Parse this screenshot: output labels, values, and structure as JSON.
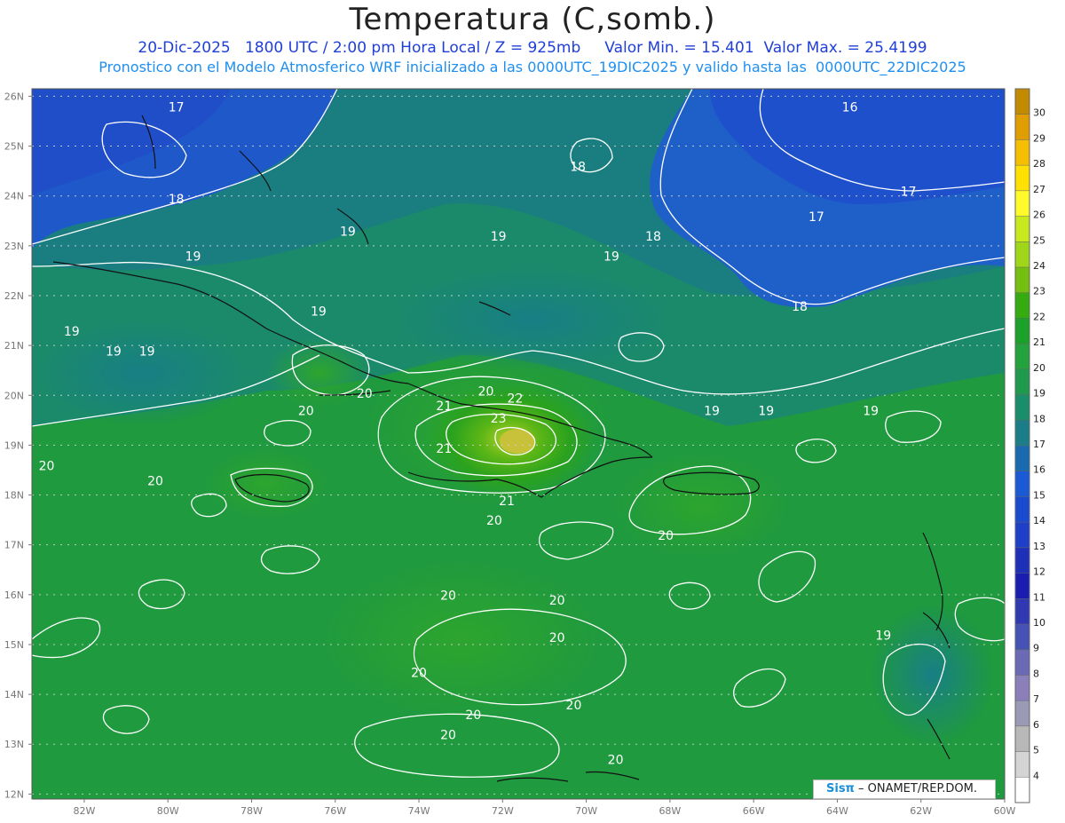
{
  "header": {
    "title": "Temperatura (C,somb.)",
    "line1": "20-Dic-2025   1800 UTC / 2:00 pm Hora Local / Z = 925mb     Valor Min. = 15.401  Valor Max. = 25.4199",
    "line2": "Pronostico con el Modelo Atmosferico WRF inicializado a las 0000UTC_19DIC2025 y valido hasta las  0000UTC_22DIC2025"
  },
  "map": {
    "lon_labels": [
      "82W",
      "80W",
      "78W",
      "76W",
      "74W",
      "72W",
      "70W",
      "68W",
      "66W",
      "64W",
      "62W",
      "60W"
    ],
    "lat_labels": [
      "26N",
      "25N",
      "24N",
      "23N",
      "22N",
      "21N",
      "20N",
      "19N",
      "18N",
      "17N",
      "16N",
      "15N",
      "14N",
      "13N",
      "12N"
    ],
    "contour_labels": [
      {
        "text": "17",
        "lon": -79.8,
        "lat": 25.7
      },
      {
        "text": "18",
        "lon": -79.8,
        "lat": 23.85
      },
      {
        "text": "19",
        "lon": -79.4,
        "lat": 22.7
      },
      {
        "text": "19",
        "lon": -82.3,
        "lat": 21.2
      },
      {
        "text": "19",
        "lon": -81.3,
        "lat": 20.8
      },
      {
        "text": "19",
        "lon": -80.5,
        "lat": 20.8
      },
      {
        "text": "19",
        "lon": -76.4,
        "lat": 21.6
      },
      {
        "text": "19",
        "lon": -75.7,
        "lat": 23.2
      },
      {
        "text": "19",
        "lon": -72.1,
        "lat": 23.1
      },
      {
        "text": "18",
        "lon": -70.2,
        "lat": 24.5
      },
      {
        "text": "19",
        "lon": -69.4,
        "lat": 22.7
      },
      {
        "text": "18",
        "lon": -68.4,
        "lat": 23.1
      },
      {
        "text": "16",
        "lon": -63.7,
        "lat": 25.7
      },
      {
        "text": "17",
        "lon": -62.3,
        "lat": 24.0
      },
      {
        "text": "17",
        "lon": -64.5,
        "lat": 23.5
      },
      {
        "text": "18",
        "lon": -64.9,
        "lat": 21.7
      },
      {
        "text": "19",
        "lon": -67.0,
        "lat": 19.6
      },
      {
        "text": "19",
        "lon": -65.7,
        "lat": 19.6
      },
      {
        "text": "19",
        "lon": -63.2,
        "lat": 19.6
      },
      {
        "text": "20",
        "lon": -75.3,
        "lat": 19.95
      },
      {
        "text": "20",
        "lon": -76.7,
        "lat": 19.6
      },
      {
        "text": "21",
        "lon": -73.4,
        "lat": 19.7
      },
      {
        "text": "20",
        "lon": -72.4,
        "lat": 20.0
      },
      {
        "text": "22",
        "lon": -71.7,
        "lat": 19.85
      },
      {
        "text": "23",
        "lon": -72.1,
        "lat": 19.45
      },
      {
        "text": "21",
        "lon": -73.4,
        "lat": 18.85
      },
      {
        "text": "21",
        "lon": -71.9,
        "lat": 17.8
      },
      {
        "text": "20",
        "lon": -72.2,
        "lat": 17.4
      },
      {
        "text": "20",
        "lon": -80.3,
        "lat": 18.2
      },
      {
        "text": "20",
        "lon": -82.9,
        "lat": 18.5
      },
      {
        "text": "20",
        "lon": -68.1,
        "lat": 17.1
      },
      {
        "text": "20",
        "lon": -73.3,
        "lat": 15.9
      },
      {
        "text": "20",
        "lon": -70.7,
        "lat": 15.8
      },
      {
        "text": "20",
        "lon": -70.7,
        "lat": 15.05
      },
      {
        "text": "20",
        "lon": -74.0,
        "lat": 14.35
      },
      {
        "text": "20",
        "lon": -72.7,
        "lat": 13.5
      },
      {
        "text": "20",
        "lon": -73.3,
        "lat": 13.1
      },
      {
        "text": "20",
        "lon": -70.3,
        "lat": 13.7
      },
      {
        "text": "20",
        "lon": -69.3,
        "lat": 12.6
      },
      {
        "text": "19",
        "lon": -62.9,
        "lat": 15.1
      }
    ]
  },
  "colorbar": {
    "labels": [
      "30",
      "29",
      "28",
      "27",
      "26",
      "25",
      "24",
      "23",
      "22",
      "21",
      "20",
      "19",
      "18",
      "17",
      "16",
      "15",
      "14",
      "13",
      "12",
      "11",
      "10",
      "9",
      "8",
      "7",
      "6",
      "5",
      "4"
    ],
    "colors": [
      "#c38a00",
      "#e09d00",
      "#f5bf00",
      "#ffe000",
      "#fffb2a",
      "#c9e91f",
      "#a0d61a",
      "#74bf10",
      "#34ac10",
      "#19a128",
      "#23a23e",
      "#1e994e",
      "#1a8d69",
      "#1a7d88",
      "#1a6ab0",
      "#1a5ad4",
      "#1a4ad0",
      "#1f3fc8",
      "#1f30b8",
      "#1b1db0",
      "#3038b2",
      "#4652b6",
      "#6a6ab6",
      "#8a7fb8",
      "#9a9ab4",
      "#b8b8b8",
      "#d4d4d4"
    ],
    "bottom_color": "#ffffff"
  },
  "credit": {
    "brand": "Sisπ",
    "text": "– ONAMET/REP.DOM."
  }
}
